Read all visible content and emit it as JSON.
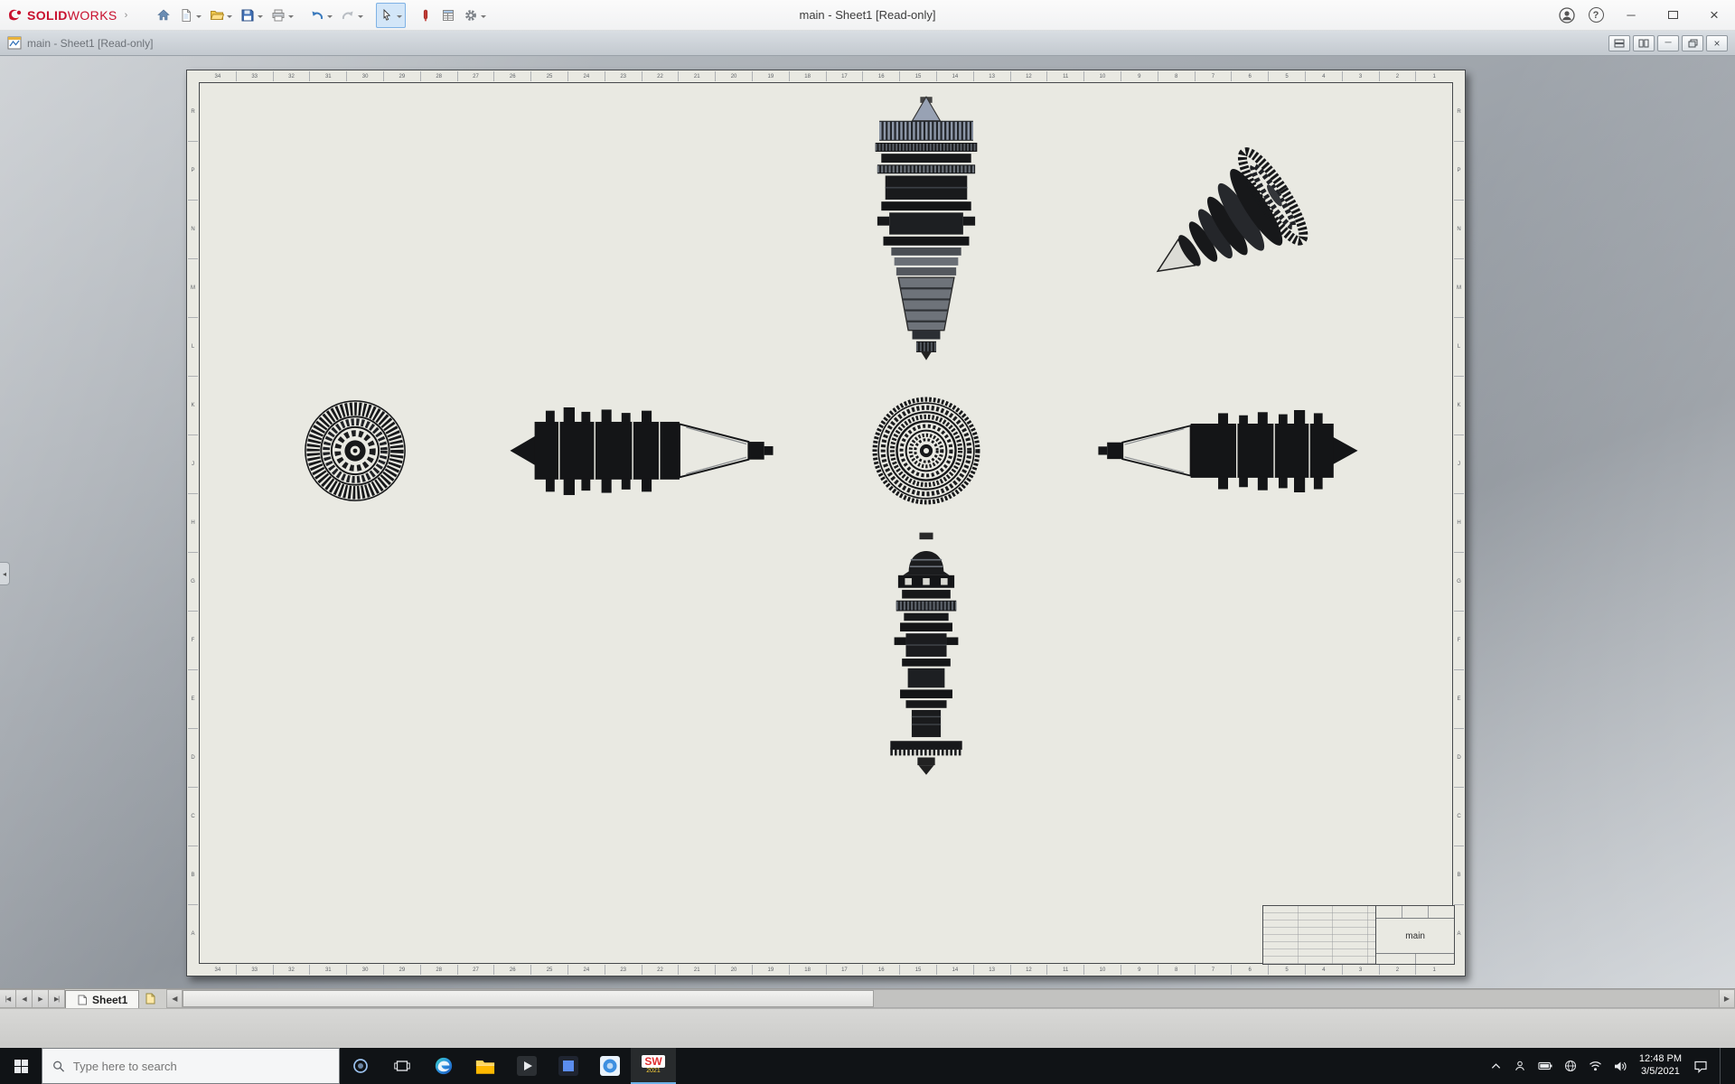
{
  "app": {
    "brand_solid": "SOLID",
    "brand_works": "WORKS",
    "window_title": "main - Sheet1 [Read-only]"
  },
  "doc": {
    "title": "main - Sheet1 [Read-only]"
  },
  "drawing": {
    "sheet_tab": "Sheet1",
    "title_block_name": "main",
    "zones_h": [
      "34",
      "33",
      "32",
      "31",
      "30",
      "29",
      "28",
      "27",
      "26",
      "25",
      "24",
      "23",
      "22",
      "21",
      "20",
      "19",
      "18",
      "17",
      "16",
      "15",
      "14",
      "13",
      "12",
      "11",
      "10",
      "9",
      "8",
      "7",
      "6",
      "5",
      "4",
      "3",
      "2",
      "1"
    ],
    "zones_v": [
      "R",
      "P",
      "N",
      "M",
      "L",
      "K",
      "J",
      "H",
      "G",
      "F",
      "E",
      "D",
      "C",
      "B",
      "A"
    ]
  },
  "glyphs": {
    "minimize": "─",
    "close": "×",
    "help": "?",
    "flyout": "›",
    "collapse_left": "◂",
    "scroll_left": "◀",
    "scroll_right": "▶",
    "nav_first": "|◀",
    "nav_prev": "◀",
    "nav_next": "▶",
    "nav_last": "▶|"
  },
  "colors": {
    "brand_red": "#c8102e",
    "sheet_paper": "#e9e9e2",
    "taskbar_black": "#101316",
    "select_highlight": "#d3e6f8"
  },
  "taskbar": {
    "search_placeholder": "Type here to search",
    "time": "12:48 PM",
    "date": "3/5/2021",
    "sw_label": "SW",
    "sw_year": "2021"
  }
}
